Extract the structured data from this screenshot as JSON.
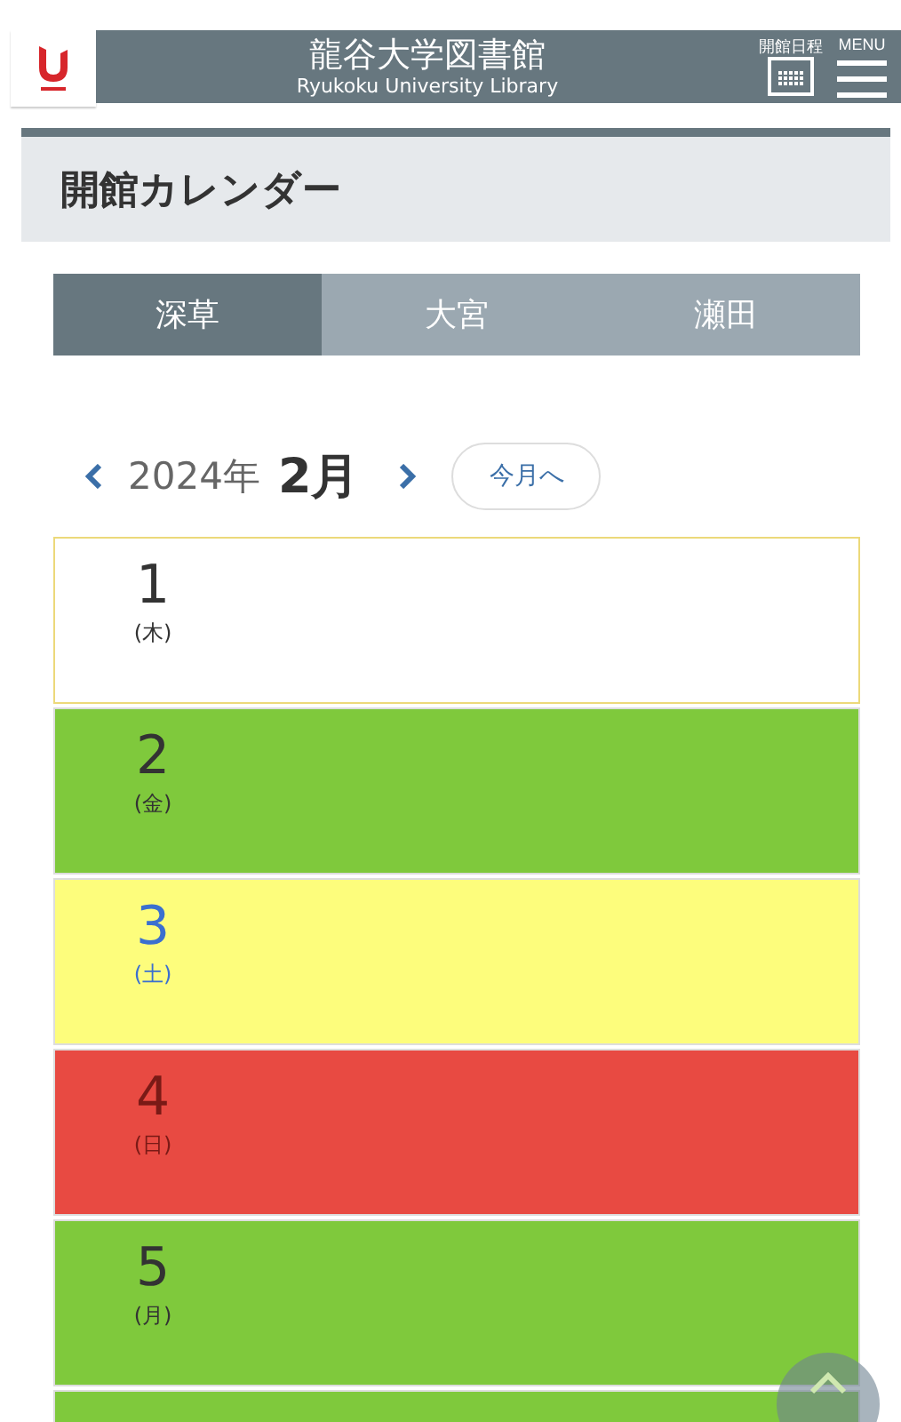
{
  "header": {
    "title": "龍谷大学図書館",
    "subtitle": "Ryukoku University Library",
    "schedule_label": "開館日程",
    "menu_label": "MENU"
  },
  "page_title": "開館カレンダー",
  "tabs": [
    {
      "label": "深草",
      "selected": true
    },
    {
      "label": "大宮",
      "selected": false
    },
    {
      "label": "瀬田",
      "selected": false
    }
  ],
  "month_nav": {
    "year": "2024年",
    "month": "2月",
    "today_button": "今月へ"
  },
  "days": [
    {
      "day": "1",
      "weekday": "(木)",
      "kind": "weekday",
      "color": "#ffffff"
    },
    {
      "day": "2",
      "weekday": "(金)",
      "kind": "weekday",
      "color": "#7fc93c"
    },
    {
      "day": "3",
      "weekday": "(土)",
      "kind": "saturday",
      "color": "#fdfd7c"
    },
    {
      "day": "4",
      "weekday": "(日)",
      "kind": "sunday",
      "color": "#e84a42"
    },
    {
      "day": "5",
      "weekday": "(月)",
      "kind": "weekday",
      "color": "#7fc93c"
    },
    {
      "kind": "weekday",
      "color": "#7fc93c"
    }
  ]
}
